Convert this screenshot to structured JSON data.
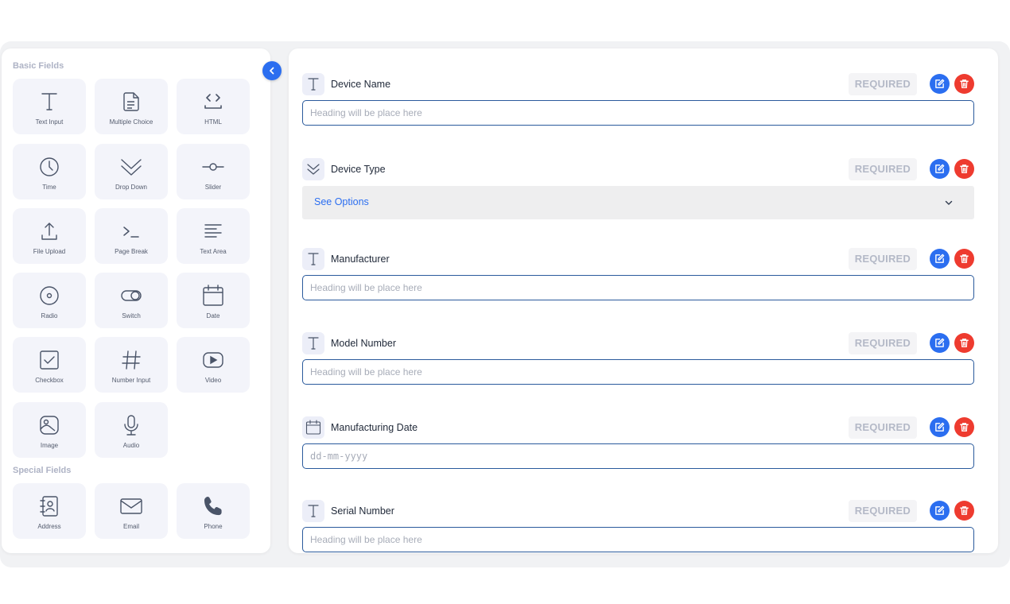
{
  "sidebar": {
    "basic_title": "Basic Fields",
    "special_title": "Special Fields",
    "basic_fields": [
      {
        "label": "Text Input",
        "icon": "text-t-icon"
      },
      {
        "label": "Multiple Choice",
        "icon": "document-icon"
      },
      {
        "label": "HTML",
        "icon": "code-icon"
      },
      {
        "label": "Time",
        "icon": "clock-icon"
      },
      {
        "label": "Drop Down",
        "icon": "chevron-down-double-icon"
      },
      {
        "label": "Slider",
        "icon": "slider-icon"
      },
      {
        "label": "File Upload",
        "icon": "upload-icon"
      },
      {
        "label": "Page Break",
        "icon": "terminal-icon"
      },
      {
        "label": "Text Area",
        "icon": "lines-icon"
      },
      {
        "label": "Radio",
        "icon": "radio-icon"
      },
      {
        "label": "Switch",
        "icon": "toggle-icon"
      },
      {
        "label": "Date",
        "icon": "calendar-icon"
      },
      {
        "label": "Checkbox",
        "icon": "checkbox-icon"
      },
      {
        "label": "Number Input",
        "icon": "hash-icon"
      },
      {
        "label": "Video",
        "icon": "video-icon"
      },
      {
        "label": "Image",
        "icon": "image-icon"
      },
      {
        "label": "Audio",
        "icon": "microphone-icon"
      }
    ],
    "special_fields": [
      {
        "label": "Address",
        "icon": "contact-book-icon"
      },
      {
        "label": "Email",
        "icon": "envelope-icon"
      },
      {
        "label": "Phone",
        "icon": "phone-icon"
      }
    ]
  },
  "form": {
    "fields": [
      {
        "title": "Device Name",
        "badge": "REQUIRED",
        "placeholder": "Heading will be place here",
        "icon": "text-t-icon"
      },
      {
        "title": "Device Type",
        "badge": "REQUIRED",
        "options_label": "See Options",
        "icon": "chevron-down-double-icon"
      },
      {
        "title": "Manufacturer",
        "badge": "REQUIRED",
        "placeholder": "Heading will be place here",
        "icon": "text-t-icon"
      },
      {
        "title": "Model Number",
        "badge": "REQUIRED",
        "placeholder": "Heading will be place here",
        "icon": "text-t-icon"
      },
      {
        "title": "Manufacturing Date",
        "badge": "REQUIRED",
        "placeholder": "dd-mm-yyyy",
        "icon": "calendar-icon"
      },
      {
        "title": "Serial Number",
        "badge": "REQUIRED",
        "placeholder": "Heading will be place here",
        "icon": "text-t-icon"
      }
    ]
  },
  "colors": {
    "accent": "#2b6ef0",
    "danger": "#ee3b2f",
    "input_border": "#2a5a9c",
    "tile_bg": "#f3f4fa"
  }
}
